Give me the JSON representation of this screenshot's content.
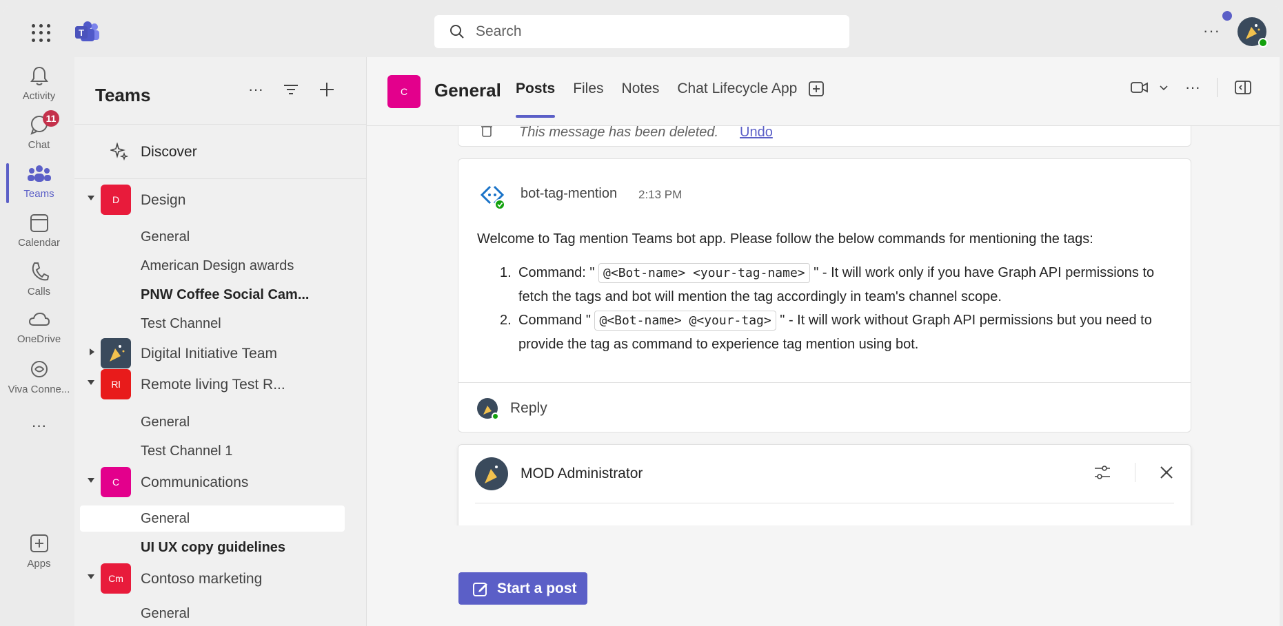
{
  "app": {
    "search_placeholder": "Search",
    "brand_color": "#5b5fc7"
  },
  "rail": {
    "items": [
      {
        "label": "Activity",
        "icon": "bell-icon"
      },
      {
        "label": "Chat",
        "icon": "chat-icon",
        "badge": "11"
      },
      {
        "label": "Teams",
        "icon": "teams-icon",
        "active": true
      },
      {
        "label": "Calendar",
        "icon": "calendar-icon"
      },
      {
        "label": "Calls",
        "icon": "phone-icon"
      },
      {
        "label": "OneDrive",
        "icon": "cloud-icon"
      },
      {
        "label": "Viva Conne...",
        "icon": "viva-icon"
      },
      {
        "label": "Apps",
        "icon": "add-app-icon"
      }
    ]
  },
  "sidebar": {
    "title": "Teams",
    "discover": "Discover",
    "teams": [
      {
        "initials": "D",
        "name": "Design",
        "color": "#e81b3b",
        "expanded": true,
        "channels": [
          {
            "name": "General",
            "bold": false
          },
          {
            "name": "American Design awards",
            "bold": false
          },
          {
            "name": "PNW Coffee Social Cam...",
            "bold": true
          },
          {
            "name": "Test Channel",
            "bold": false
          }
        ]
      },
      {
        "initials": "",
        "name": "Digital Initiative Team",
        "color": "#3a4a5c",
        "expanded": false,
        "channels": []
      },
      {
        "initials": "Rl",
        "name": "Remote living Test R...",
        "color": "#e81b1b",
        "expanded": true,
        "channels": [
          {
            "name": "General",
            "bold": false
          },
          {
            "name": "Test Channel 1",
            "bold": false
          }
        ]
      },
      {
        "initials": "C",
        "name": "Communications",
        "color": "#e3008c",
        "expanded": true,
        "channels": [
          {
            "name": "General",
            "bold": false,
            "selected": true
          },
          {
            "name": "UI UX copy guidelines",
            "bold": true
          }
        ]
      },
      {
        "initials": "Cm",
        "name": "Contoso marketing",
        "color": "#e81b3b",
        "expanded": true,
        "channels": [
          {
            "name": "General",
            "bold": false
          }
        ]
      }
    ]
  },
  "channel": {
    "tile_initial": "C",
    "title": "General",
    "tabs": [
      "Posts",
      "Files",
      "Notes",
      "Chat Lifecycle App"
    ],
    "active_tab": "Posts"
  },
  "feed": {
    "deleted_text": "This message has been deleted.",
    "undo_label": "Undo",
    "message": {
      "author": "bot-tag-mention",
      "time": "2:13 PM",
      "intro": "Welcome to Tag mention Teams bot app. Please follow the below commands for mentioning the tags:",
      "cmd1_prefix": "Command: \"",
      "cmd1_code": "@<Bot-name> <your-tag-name>",
      "cmd1_suffix": "\" - It will work only if you have Graph API permissions to fetch the tags and bot will mention the tag accordingly in team's channel scope.",
      "cmd2_prefix": "Command \"",
      "cmd2_code": "@<Bot-name> @<your-tag>",
      "cmd2_suffix": "\" - It will work without Graph API permissions but you need to provide the tag as command to experience tag mention using bot."
    },
    "reply_label": "Reply",
    "compose_author": "MOD Administrator",
    "start_post_label": "Start a post"
  }
}
